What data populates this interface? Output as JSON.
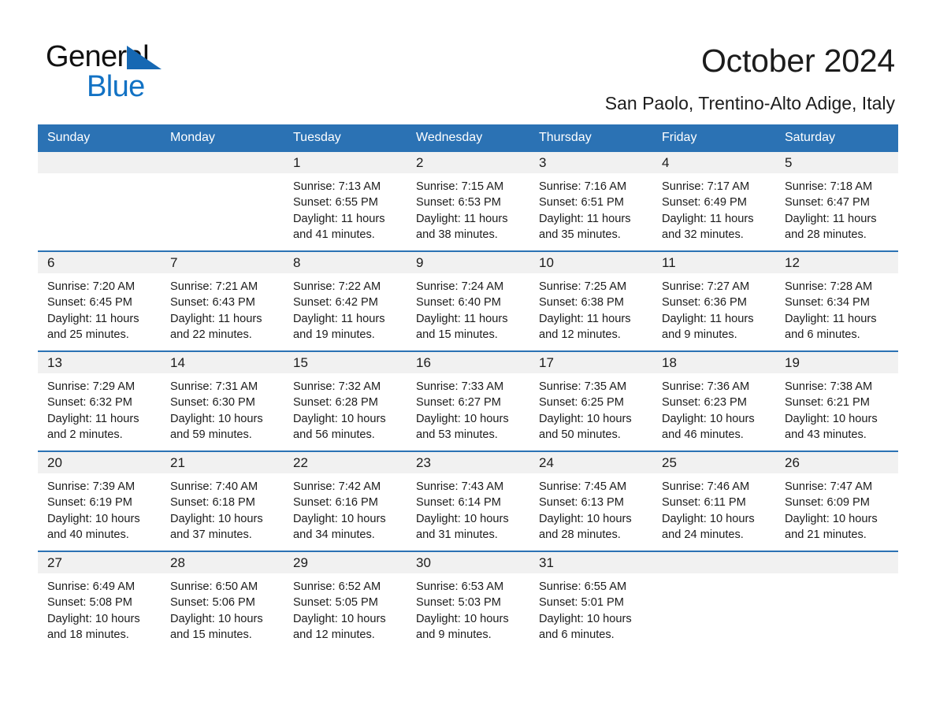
{
  "logo": {
    "word_general": "General",
    "word_blue": "Blue",
    "accent_color": "#1272c4",
    "triangle_color": "#1668b3"
  },
  "header": {
    "title": "October 2024",
    "subtitle": "San Paolo, Trentino-Alto Adige, Italy",
    "header_bg_color": "#2b72b4",
    "date_band_color": "#f1f1f1"
  },
  "weekday_headers": [
    "Sunday",
    "Monday",
    "Tuesday",
    "Wednesday",
    "Thursday",
    "Friday",
    "Saturday"
  ],
  "labels": {
    "sunrise_prefix": "Sunrise:",
    "sunset_prefix": "Sunset:",
    "daylight_prefix": "Daylight:"
  },
  "weeks": [
    [
      {
        "day": "",
        "sunrise": "",
        "sunset": "",
        "daylight_line1": "",
        "daylight_line2": ""
      },
      {
        "day": "",
        "sunrise": "",
        "sunset": "",
        "daylight_line1": "",
        "daylight_line2": ""
      },
      {
        "day": "1",
        "sunrise": "Sunrise: 7:13 AM",
        "sunset": "Sunset: 6:55 PM",
        "daylight_line1": "Daylight: 11 hours",
        "daylight_line2": "and 41 minutes."
      },
      {
        "day": "2",
        "sunrise": "Sunrise: 7:15 AM",
        "sunset": "Sunset: 6:53 PM",
        "daylight_line1": "Daylight: 11 hours",
        "daylight_line2": "and 38 minutes."
      },
      {
        "day": "3",
        "sunrise": "Sunrise: 7:16 AM",
        "sunset": "Sunset: 6:51 PM",
        "daylight_line1": "Daylight: 11 hours",
        "daylight_line2": "and 35 minutes."
      },
      {
        "day": "4",
        "sunrise": "Sunrise: 7:17 AM",
        "sunset": "Sunset: 6:49 PM",
        "daylight_line1": "Daylight: 11 hours",
        "daylight_line2": "and 32 minutes."
      },
      {
        "day": "5",
        "sunrise": "Sunrise: 7:18 AM",
        "sunset": "Sunset: 6:47 PM",
        "daylight_line1": "Daylight: 11 hours",
        "daylight_line2": "and 28 minutes."
      }
    ],
    [
      {
        "day": "6",
        "sunrise": "Sunrise: 7:20 AM",
        "sunset": "Sunset: 6:45 PM",
        "daylight_line1": "Daylight: 11 hours",
        "daylight_line2": "and 25 minutes."
      },
      {
        "day": "7",
        "sunrise": "Sunrise: 7:21 AM",
        "sunset": "Sunset: 6:43 PM",
        "daylight_line1": "Daylight: 11 hours",
        "daylight_line2": "and 22 minutes."
      },
      {
        "day": "8",
        "sunrise": "Sunrise: 7:22 AM",
        "sunset": "Sunset: 6:42 PM",
        "daylight_line1": "Daylight: 11 hours",
        "daylight_line2": "and 19 minutes."
      },
      {
        "day": "9",
        "sunrise": "Sunrise: 7:24 AM",
        "sunset": "Sunset: 6:40 PM",
        "daylight_line1": "Daylight: 11 hours",
        "daylight_line2": "and 15 minutes."
      },
      {
        "day": "10",
        "sunrise": "Sunrise: 7:25 AM",
        "sunset": "Sunset: 6:38 PM",
        "daylight_line1": "Daylight: 11 hours",
        "daylight_line2": "and 12 minutes."
      },
      {
        "day": "11",
        "sunrise": "Sunrise: 7:27 AM",
        "sunset": "Sunset: 6:36 PM",
        "daylight_line1": "Daylight: 11 hours",
        "daylight_line2": "and 9 minutes."
      },
      {
        "day": "12",
        "sunrise": "Sunrise: 7:28 AM",
        "sunset": "Sunset: 6:34 PM",
        "daylight_line1": "Daylight: 11 hours",
        "daylight_line2": "and 6 minutes."
      }
    ],
    [
      {
        "day": "13",
        "sunrise": "Sunrise: 7:29 AM",
        "sunset": "Sunset: 6:32 PM",
        "daylight_line1": "Daylight: 11 hours",
        "daylight_line2": "and 2 minutes."
      },
      {
        "day": "14",
        "sunrise": "Sunrise: 7:31 AM",
        "sunset": "Sunset: 6:30 PM",
        "daylight_line1": "Daylight: 10 hours",
        "daylight_line2": "and 59 minutes."
      },
      {
        "day": "15",
        "sunrise": "Sunrise: 7:32 AM",
        "sunset": "Sunset: 6:28 PM",
        "daylight_line1": "Daylight: 10 hours",
        "daylight_line2": "and 56 minutes."
      },
      {
        "day": "16",
        "sunrise": "Sunrise: 7:33 AM",
        "sunset": "Sunset: 6:27 PM",
        "daylight_line1": "Daylight: 10 hours",
        "daylight_line2": "and 53 minutes."
      },
      {
        "day": "17",
        "sunrise": "Sunrise: 7:35 AM",
        "sunset": "Sunset: 6:25 PM",
        "daylight_line1": "Daylight: 10 hours",
        "daylight_line2": "and 50 minutes."
      },
      {
        "day": "18",
        "sunrise": "Sunrise: 7:36 AM",
        "sunset": "Sunset: 6:23 PM",
        "daylight_line1": "Daylight: 10 hours",
        "daylight_line2": "and 46 minutes."
      },
      {
        "day": "19",
        "sunrise": "Sunrise: 7:38 AM",
        "sunset": "Sunset: 6:21 PM",
        "daylight_line1": "Daylight: 10 hours",
        "daylight_line2": "and 43 minutes."
      }
    ],
    [
      {
        "day": "20",
        "sunrise": "Sunrise: 7:39 AM",
        "sunset": "Sunset: 6:19 PM",
        "daylight_line1": "Daylight: 10 hours",
        "daylight_line2": "and 40 minutes."
      },
      {
        "day": "21",
        "sunrise": "Sunrise: 7:40 AM",
        "sunset": "Sunset: 6:18 PM",
        "daylight_line1": "Daylight: 10 hours",
        "daylight_line2": "and 37 minutes."
      },
      {
        "day": "22",
        "sunrise": "Sunrise: 7:42 AM",
        "sunset": "Sunset: 6:16 PM",
        "daylight_line1": "Daylight: 10 hours",
        "daylight_line2": "and 34 minutes."
      },
      {
        "day": "23",
        "sunrise": "Sunrise: 7:43 AM",
        "sunset": "Sunset: 6:14 PM",
        "daylight_line1": "Daylight: 10 hours",
        "daylight_line2": "and 31 minutes."
      },
      {
        "day": "24",
        "sunrise": "Sunrise: 7:45 AM",
        "sunset": "Sunset: 6:13 PM",
        "daylight_line1": "Daylight: 10 hours",
        "daylight_line2": "and 28 minutes."
      },
      {
        "day": "25",
        "sunrise": "Sunrise: 7:46 AM",
        "sunset": "Sunset: 6:11 PM",
        "daylight_line1": "Daylight: 10 hours",
        "daylight_line2": "and 24 minutes."
      },
      {
        "day": "26",
        "sunrise": "Sunrise: 7:47 AM",
        "sunset": "Sunset: 6:09 PM",
        "daylight_line1": "Daylight: 10 hours",
        "daylight_line2": "and 21 minutes."
      }
    ],
    [
      {
        "day": "27",
        "sunrise": "Sunrise: 6:49 AM",
        "sunset": "Sunset: 5:08 PM",
        "daylight_line1": "Daylight: 10 hours",
        "daylight_line2": "and 18 minutes."
      },
      {
        "day": "28",
        "sunrise": "Sunrise: 6:50 AM",
        "sunset": "Sunset: 5:06 PM",
        "daylight_line1": "Daylight: 10 hours",
        "daylight_line2": "and 15 minutes."
      },
      {
        "day": "29",
        "sunrise": "Sunrise: 6:52 AM",
        "sunset": "Sunset: 5:05 PM",
        "daylight_line1": "Daylight: 10 hours",
        "daylight_line2": "and 12 minutes."
      },
      {
        "day": "30",
        "sunrise": "Sunrise: 6:53 AM",
        "sunset": "Sunset: 5:03 PM",
        "daylight_line1": "Daylight: 10 hours",
        "daylight_line2": "and 9 minutes."
      },
      {
        "day": "31",
        "sunrise": "Sunrise: 6:55 AM",
        "sunset": "Sunset: 5:01 PM",
        "daylight_line1": "Daylight: 10 hours",
        "daylight_line2": "and 6 minutes."
      },
      {
        "day": "",
        "sunrise": "",
        "sunset": "",
        "daylight_line1": "",
        "daylight_line2": ""
      },
      {
        "day": "",
        "sunrise": "",
        "sunset": "",
        "daylight_line1": "",
        "daylight_line2": ""
      }
    ]
  ]
}
